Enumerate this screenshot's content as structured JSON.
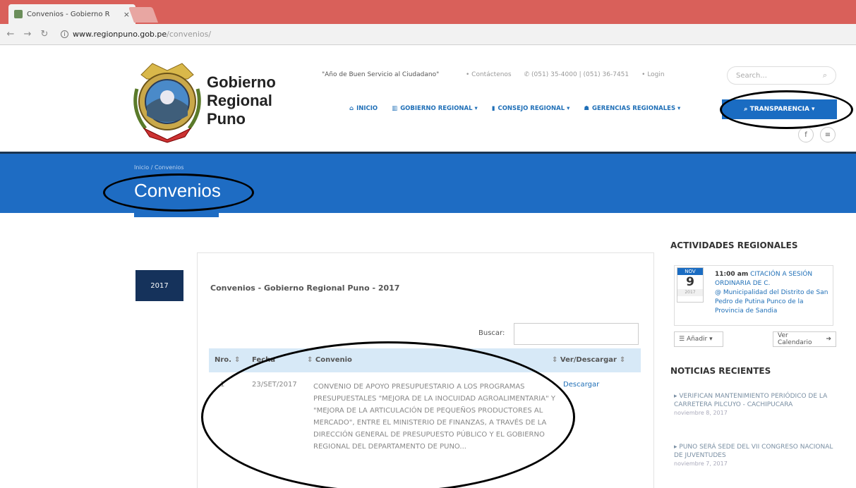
{
  "browser": {
    "tab_title": "Convenios - Gobierno R",
    "tab_close": "×",
    "url_domain": "www.regionpuno.gob.pe",
    "url_path": "/convenios/"
  },
  "header": {
    "site_name_1": "Gobierno",
    "site_name_2": "Regional",
    "site_name_3": "Puno",
    "motto": "\"Año de Buen Servicio al Ciudadano\"",
    "contact": "Contáctenos",
    "phone": "(051) 35-4000 | (051) 36-7451",
    "login": "Login",
    "search_placeholder": "Search..."
  },
  "nav": {
    "inicio": "INICIO",
    "gobierno": "GOBIERNO REGIONAL",
    "consejo": "CONSEJO REGIONAL",
    "gerencias": "GERENCIAS REGIONALES",
    "transparencia": "TRANSPARENCIA"
  },
  "banner": {
    "breadcrumb": "Inicio / Convenios",
    "title": "Convenios"
  },
  "main": {
    "year_tab": "2017",
    "panel_title": "Convenios - Gobierno Regional Puno - 2017",
    "search_label": "Buscar:",
    "columns": {
      "nro": "Nro.",
      "fecha": "Fecha",
      "convenio": "Convenio",
      "ver": "Ver/Descargar"
    },
    "row": {
      "nro": "1",
      "fecha": "23/SET/2017",
      "convenio": "Convenio de apoyo presupuestario a los programas presupuestales \"Mejora de la inocuidad agroalimentaria\" y \"Mejora de la articulación de pequeños productores al mercado\", entre el Ministerio de Finanzas, a través de la Dirección General de Presupuesto Público y el Gobierno Regional del Departamento de Puno...",
      "link": "Descargar"
    }
  },
  "sidebar": {
    "activities_title": "ACTIVIDADES REGIONALES",
    "event": {
      "month": "NOV",
      "day": "9",
      "year": "2017",
      "time": "11:00 am",
      "text": "CITACIÓN A SESIÓN ORDINARIA DE C.",
      "location": "@ Municipalidad del Distrito de San Pedro de Putina Punco de la Provincia de Sandia"
    },
    "add_button": "Añadir",
    "calendar_button": "Ver Calendario",
    "news_title": "NOTICIAS RECIENTES",
    "news": [
      {
        "title": "Verifican mantenimiento periódico de la carretera Pilcuyo - Cachipucara",
        "date": "noviembre 8, 2017"
      },
      {
        "title": "Puno será sede del VII Congreso Nacional de Juventudes",
        "date": "noviembre 7, 2017"
      }
    ]
  },
  "colors": {
    "brand_blue": "#1e6cc3",
    "dark_navy": "#15325b",
    "browser_red": "#d9605a"
  }
}
